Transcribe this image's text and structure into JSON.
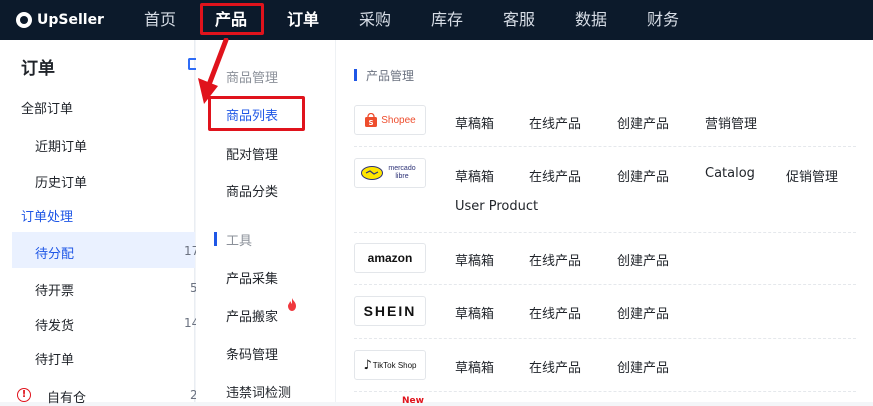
{
  "app": {
    "logo_text": "UpSeller"
  },
  "topnav": {
    "items": [
      {
        "label": "首页"
      },
      {
        "label": "产品"
      },
      {
        "label": "订单"
      },
      {
        "label": "采购"
      },
      {
        "label": "库存"
      },
      {
        "label": "客服"
      },
      {
        "label": "数据"
      },
      {
        "label": "财务"
      }
    ],
    "active_index": 1
  },
  "sidebar": {
    "title": "订单",
    "all_orders": "全部订单",
    "recent_orders": "近期订单",
    "history_orders": "历史订单",
    "processing": "订单处理",
    "items": [
      {
        "label": "待分配",
        "count": "17"
      },
      {
        "label": "待开票",
        "count": "5"
      },
      {
        "label": "待发货",
        "count": "14"
      },
      {
        "label": "待打单",
        "count": ""
      },
      {
        "label": "自有仓",
        "count": "2"
      }
    ]
  },
  "product_menu": {
    "section1_title": "商品管理",
    "section1_items": [
      "商品列表",
      "配对管理",
      "商品分类"
    ],
    "section2_title": "工具",
    "section2_items": [
      "产品采集",
      "产品搬家",
      "条码管理",
      "违禁词检测"
    ]
  },
  "content": {
    "section_title": "产品管理",
    "platforms": [
      {
        "name": "Shopee",
        "links": [
          "草稿箱",
          "在线产品",
          "创建产品",
          "营销管理"
        ]
      },
      {
        "name": "mercado libre",
        "links": [
          "草稿箱",
          "在线产品",
          "创建产品",
          "Catalog",
          "促销管理",
          "User Product"
        ]
      },
      {
        "name": "amazon",
        "links": [
          "草稿箱",
          "在线产品",
          "创建产品"
        ]
      },
      {
        "name": "SHEIN",
        "links": [
          "草稿箱",
          "在线产品",
          "创建产品"
        ]
      },
      {
        "name": "TikTok Shop",
        "links": [
          "草稿箱",
          "在线产品",
          "创建产品"
        ]
      }
    ],
    "new_badge": "New"
  },
  "colors": {
    "accent": "#1f57e6",
    "highlight": "#e0131c",
    "topbar": "#0c1a2b"
  }
}
